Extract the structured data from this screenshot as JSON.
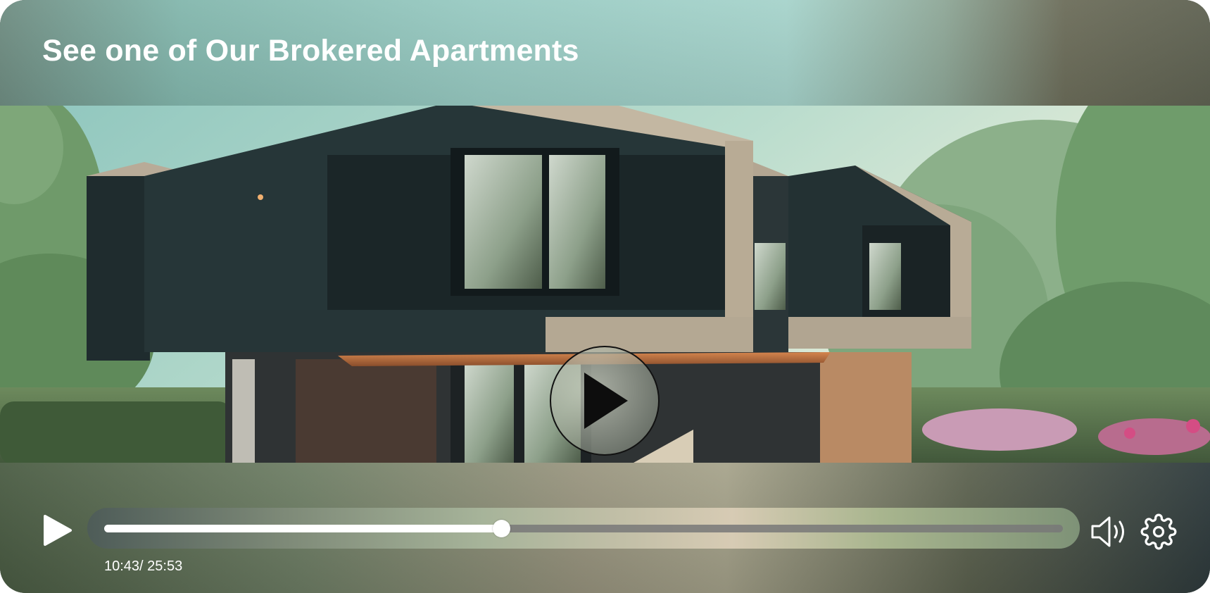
{
  "player": {
    "title": "See one of Our Brokered Apartments",
    "video": {
      "alt": "Modern dark two-storey house with cantilevered boxes among green trees"
    },
    "controls": {
      "play_icon": "play-icon",
      "current_time": "10:43",
      "duration": "25:53",
      "time_display": "10:43/ 25:53",
      "progress_fraction": 0.414,
      "volume_icon": "speaker-volume-icon",
      "settings_icon": "gear-icon"
    },
    "colors": {
      "accent": "#ffffff",
      "rail": "#787878"
    }
  }
}
